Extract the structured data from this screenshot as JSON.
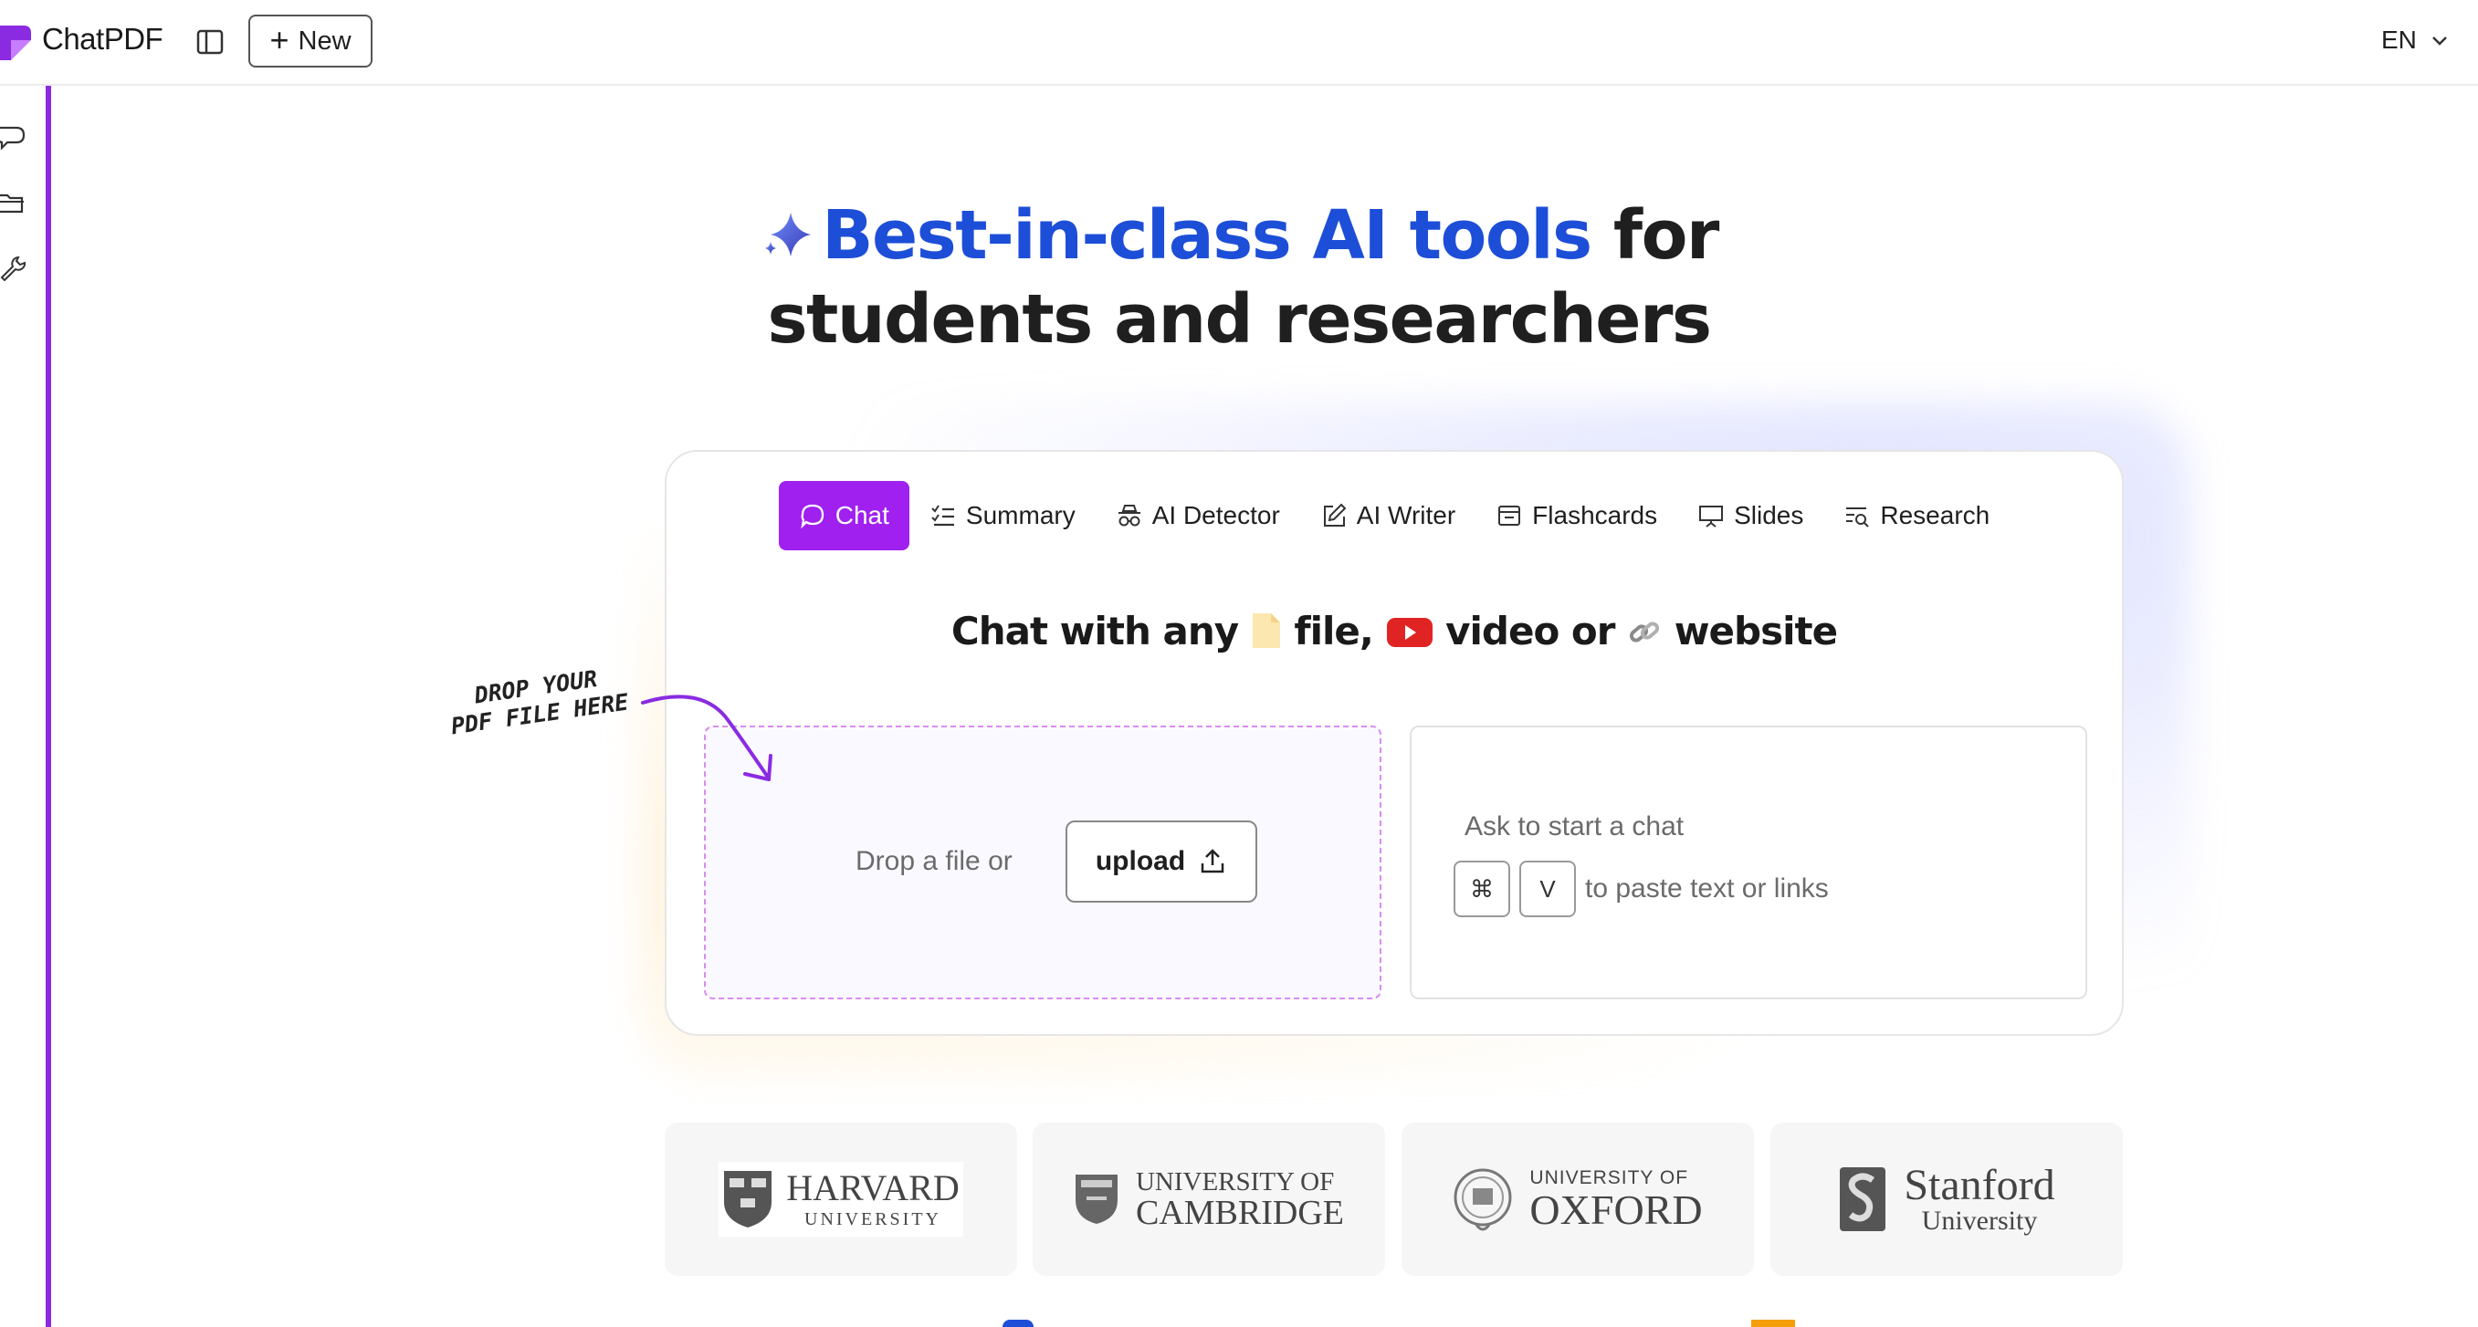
{
  "app": {
    "name": "ChatPDF",
    "new_label": "New",
    "lang_label": "EN"
  },
  "hero": {
    "title_accent": "Best-in-class AI tools",
    "title_rest_line1": " for",
    "title_line2": "students and researchers"
  },
  "tabs": [
    {
      "label": "Chat",
      "icon": "chat-bubble-icon",
      "active": true
    },
    {
      "label": "Summary",
      "icon": "checklist-icon"
    },
    {
      "label": "AI Detector",
      "icon": "spy-icon"
    },
    {
      "label": "AI Writer",
      "icon": "pencil-square-icon"
    },
    {
      "label": "Flashcards",
      "icon": "card-stack-icon"
    },
    {
      "label": "Slides",
      "icon": "presentation-icon"
    },
    {
      "label": "Research",
      "icon": "search-list-icon"
    }
  ],
  "card": {
    "title_part1": "Chat with any",
    "title_part2": "file,",
    "title_part3": "video or",
    "title_part4": "website"
  },
  "dropzone": {
    "label": "Drop a file or",
    "upload_label": "upload"
  },
  "note": {
    "line1": "DROP YOUR",
    "line2": "PDF FILE HERE"
  },
  "ask": {
    "placeholder": "Ask to start a chat",
    "key1": "⌘",
    "key2": "V",
    "hint": "to paste text or links"
  },
  "logos": [
    {
      "name": "Harvard",
      "line1": "HARVARD",
      "line2": "UNIVERSITY"
    },
    {
      "name": "Cambridge",
      "line1": "UNIVERSITY OF",
      "line2": "CAMBRIDGE"
    },
    {
      "name": "Oxford",
      "line1": "UNIVERSITY OF",
      "line2": "OXFORD"
    },
    {
      "name": "Stanford",
      "line1": "Stanford",
      "line2": "University"
    }
  ],
  "colors": {
    "accent": "#a020f0",
    "hero_blue": "#1d4ed8",
    "rail": "#8a2be2",
    "drop_border": "#d98cf0"
  }
}
